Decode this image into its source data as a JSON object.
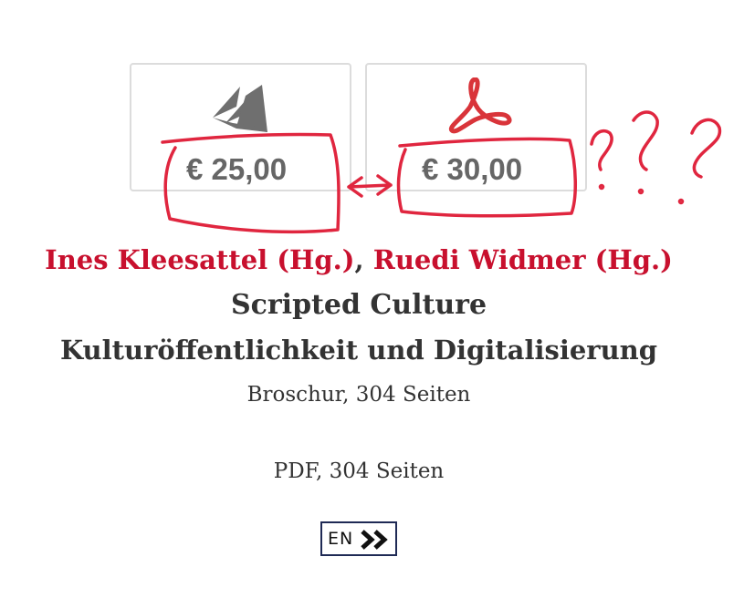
{
  "offers": [
    {
      "icon": "book-icon",
      "price": "€ 25,00"
    },
    {
      "icon": "pdf-icon",
      "price": "€ 30,00"
    }
  ],
  "book": {
    "authors": [
      "Ines Kleesattel (Hg.)",
      "Ruedi Widmer (Hg.)"
    ],
    "author_separator": ",",
    "title": "Scripted Culture",
    "subtitle": "Kulturöffentlichkeit und Digitalisierung",
    "formats": [
      "Broschur, 304 Seiten",
      "PDF, 304 Seiten"
    ]
  },
  "language_switch": {
    "label": "EN",
    "icon": "double-chevron-right-icon"
  },
  "annotation": {
    "marks": "?  ?  ?",
    "color": "#e0263f"
  }
}
